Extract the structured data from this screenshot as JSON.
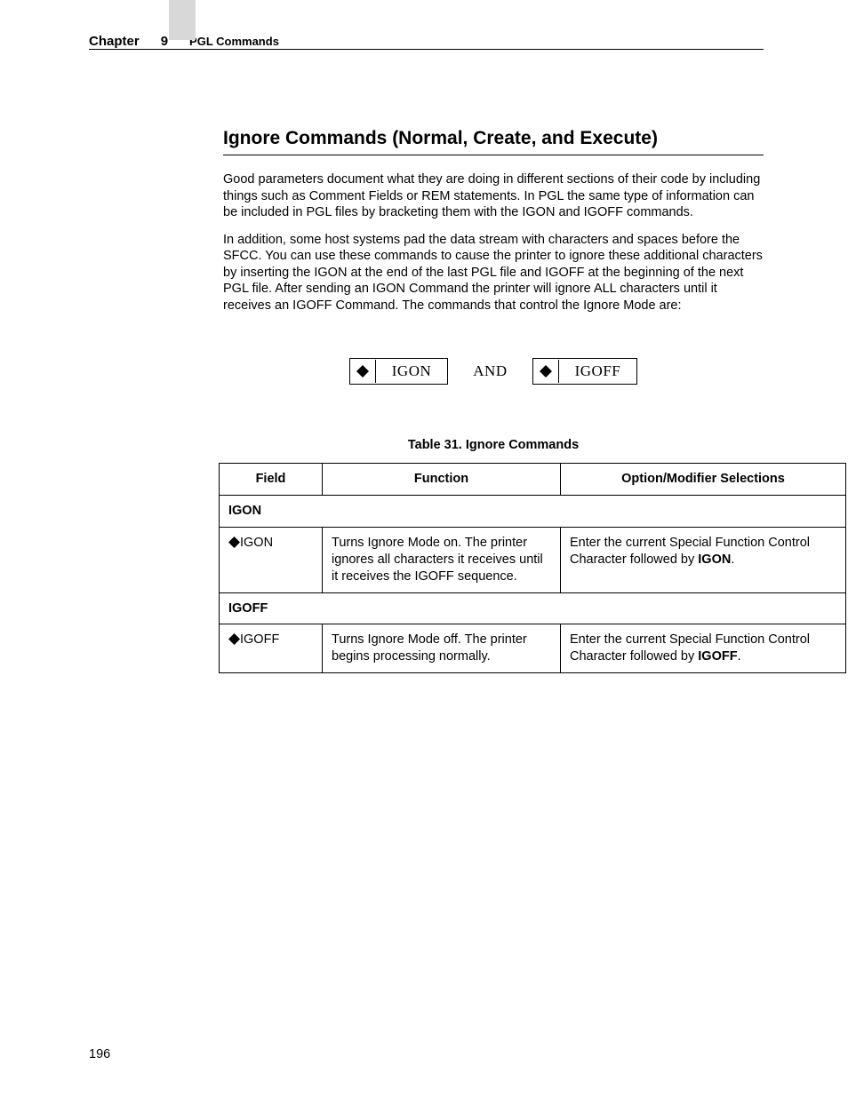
{
  "header": {
    "chapter_label": "Chapter",
    "chapter_number": "9",
    "section_name": "PGL Commands"
  },
  "section_title": "Ignore Commands (Normal, Create, and Execute)",
  "paragraphs": {
    "p1": "Good parameters document what they are doing in different sections of their code by including things such as Comment Fields or REM statements. In PGL the same type of information can be included in PGL files by bracketing them with the IGON and IGOFF commands.",
    "p2": "In addition, some host systems pad the data stream with characters and spaces before the SFCC. You can use these commands to cause the printer to ignore these additional characters by inserting the IGON at the end of the last PGL file and IGOFF at the beginning of the next PGL file. After sending an IGON Command the printer will ignore ALL characters until it receives an IGOFF Command. The commands that control the Ignore Mode are:"
  },
  "command_boxes": {
    "left": "IGON",
    "and": "AND",
    "right": "IGOFF"
  },
  "table_caption": "Table 31. Ignore Commands",
  "table": {
    "headers": {
      "field": "Field",
      "function": "Function",
      "option": "Option/Modifier Selections"
    },
    "group1": {
      "name": "IGON",
      "field": "IGON",
      "function": "Turns Ignore Mode on. The printer ignores all characters it receives until it receives the IGOFF sequence.",
      "option_prefix": "Enter the current Special Function Control Character followed by ",
      "option_bold": "IGON",
      "option_suffix": "."
    },
    "group2": {
      "name": "IGOFF",
      "field": "IGOFF",
      "function": "Turns Ignore Mode off. The printer begins processing normally.",
      "option_prefix": "Enter the current Special Function Control Character followed by ",
      "option_bold": "IGOFF",
      "option_suffix": "."
    }
  },
  "page_number": "196"
}
